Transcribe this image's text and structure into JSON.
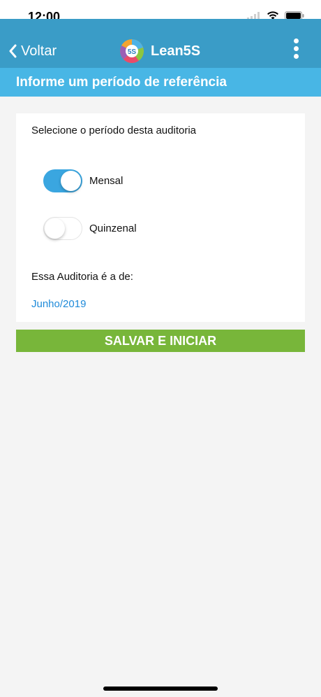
{
  "status_bar": {
    "time": "12:00"
  },
  "nav": {
    "back_label": "Voltar",
    "brand": "Lean5S",
    "logo_badge": "5S"
  },
  "sub_header": {
    "title": "Informe um período de referência"
  },
  "form": {
    "prompt": "Selecione o período desta auditoria",
    "options": [
      {
        "label": "Mensal",
        "on": true
      },
      {
        "label": "Quinzenal",
        "on": false
      }
    ],
    "period_label": "Essa Auditoria é a de:",
    "period_value": "Junho/2019"
  },
  "actions": {
    "save_label": "SALVAR E INICIAR"
  },
  "colors": {
    "nav_bg": "#3a9cc7",
    "sub_header_bg": "#48b6e5",
    "toggle_on": "#3aa6e0",
    "link": "#1e8ad9",
    "save_button": "#78b63a"
  }
}
